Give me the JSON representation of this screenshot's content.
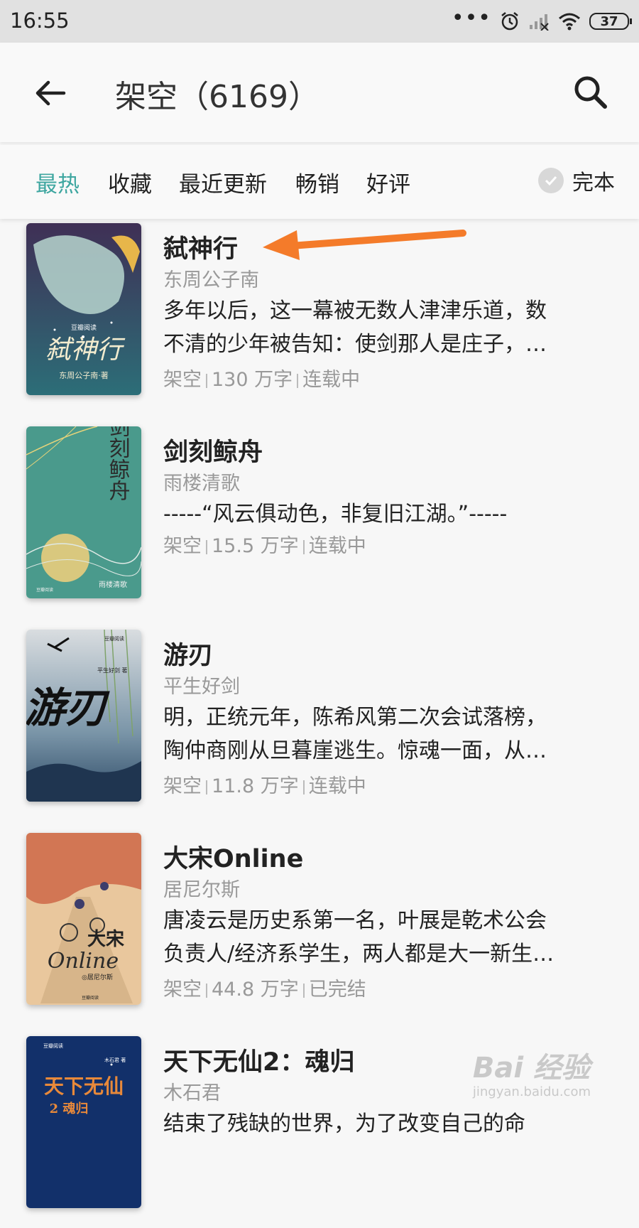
{
  "status": {
    "time": "16:55",
    "battery": "37",
    "dots": "•••"
  },
  "header": {
    "title": "架空（6169）"
  },
  "filters": {
    "tabs": [
      {
        "label": "最热",
        "active": true
      },
      {
        "label": "收藏",
        "active": false
      },
      {
        "label": "最近更新",
        "active": false
      },
      {
        "label": "畅销",
        "active": false
      },
      {
        "label": "好评",
        "active": false
      }
    ],
    "complete_label": "完本"
  },
  "books": [
    {
      "title": "弑神行",
      "author": "东周公子南",
      "desc": [
        "多年以后，这一幕被无数人津津乐道，数",
        "不清的少年被告知：使剑那人是庄子，…"
      ],
      "category": "架空",
      "words": "130 万字",
      "status": "连载中",
      "cover_text": "弑神行",
      "cover_author": "东周公子南·著",
      "cover_brand": "豆瓣阅读"
    },
    {
      "title": "剑刻鲸舟",
      "author": "雨楼清歌",
      "desc": [
        "-----“风云俱动色，非复旧江湖。”-----"
      ],
      "category": "架空",
      "words": "15.5 万字",
      "status": "连载中",
      "cover_text": "剑刻鲸舟",
      "cover_author": "雨楼清歌",
      "cover_brand": "豆瓣阅读"
    },
    {
      "title": "游刃",
      "author": "平生好剑",
      "desc": [
        "明，正统元年，陈希风第二次会试落榜，",
        "陶仲商刚从旦暮崖逃生。惊魂一面，从…"
      ],
      "category": "架空",
      "words": "11.8 万字",
      "status": "连载中",
      "cover_text": "游刃",
      "cover_author": "平生好剑 著",
      "cover_brand": "豆瓣阅读"
    },
    {
      "title": "大宋Online",
      "author": "居尼尔斯",
      "desc": [
        "唐凌云是历史系第一名，叶展是乾术公会",
        "负责人/经济系学生，两人都是大一新生…"
      ],
      "category": "架空",
      "words": "44.8 万字",
      "status": "已完结",
      "cover_text": "大宋",
      "cover_text2": "Online",
      "cover_author": "◎居尼尔斯",
      "cover_brand": "豆瓣阅读"
    },
    {
      "title": "天下无仙2：魂归",
      "author": "木石君",
      "desc": [
        "结束了残缺的世界，为了改变自己的命"
      ],
      "cover_text": "天下无仙",
      "cover_text2": "2 魂归",
      "cover_author": "木石君 著",
      "cover_brand": "豆瓣阅读"
    }
  ],
  "watermark": {
    "logo": "Bai 经验",
    "url": "jingyan.baidu.com"
  },
  "colors": {
    "accent": "#3ea6a0",
    "arrow": "#f47b2a"
  }
}
